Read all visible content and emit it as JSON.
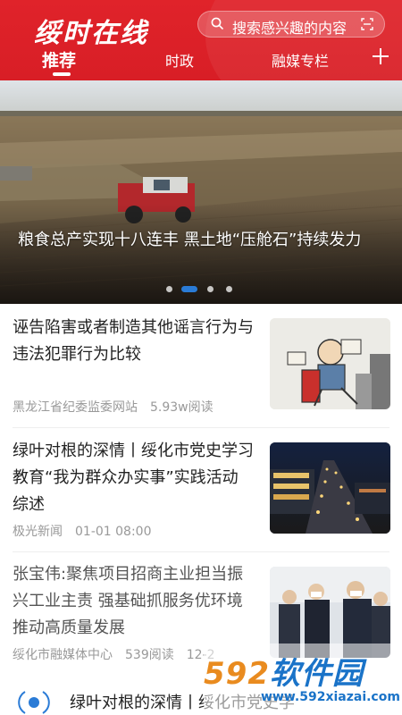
{
  "header": {
    "logo": "绥时在线",
    "search_placeholder": "搜索感兴趣的内容",
    "tabs": [
      {
        "label": "推荐",
        "active": true
      },
      {
        "label": "时政",
        "active": false
      },
      {
        "label": "融媒专栏",
        "active": false
      }
    ],
    "accent_color": "#e0232a"
  },
  "banner": {
    "title": "粮食总产实现十八连丰 黑土地“压舱石”持续发力",
    "slide_count": 4,
    "active_slide": 2
  },
  "articles": [
    {
      "title": "诬告陷害或者制造其他谣言行为与违法犯罪行为比较",
      "source": "黑龙江省纪委监委网站",
      "reads": "5.93w阅读",
      "date": ""
    },
    {
      "title": "绿叶对根的深情丨绥化市党史学习教育“我为群众办实事”实践活动综述",
      "source": "极光新闻",
      "reads": "",
      "date": "01-01 08:00"
    },
    {
      "title": "张宝伟:聚焦项目招商主业担当振兴工业主责 强基础抓服务优环境推动高质量发展",
      "source": "绥化市融媒体中心",
      "reads": "539阅读",
      "date": "12-2"
    }
  ],
  "bottom_item": {
    "title": "绿叶对根的深情丨绥化市党史学"
  },
  "watermark": {
    "brand_num": "592",
    "brand_text": "软件园",
    "url": "www.592xiazai.com"
  }
}
